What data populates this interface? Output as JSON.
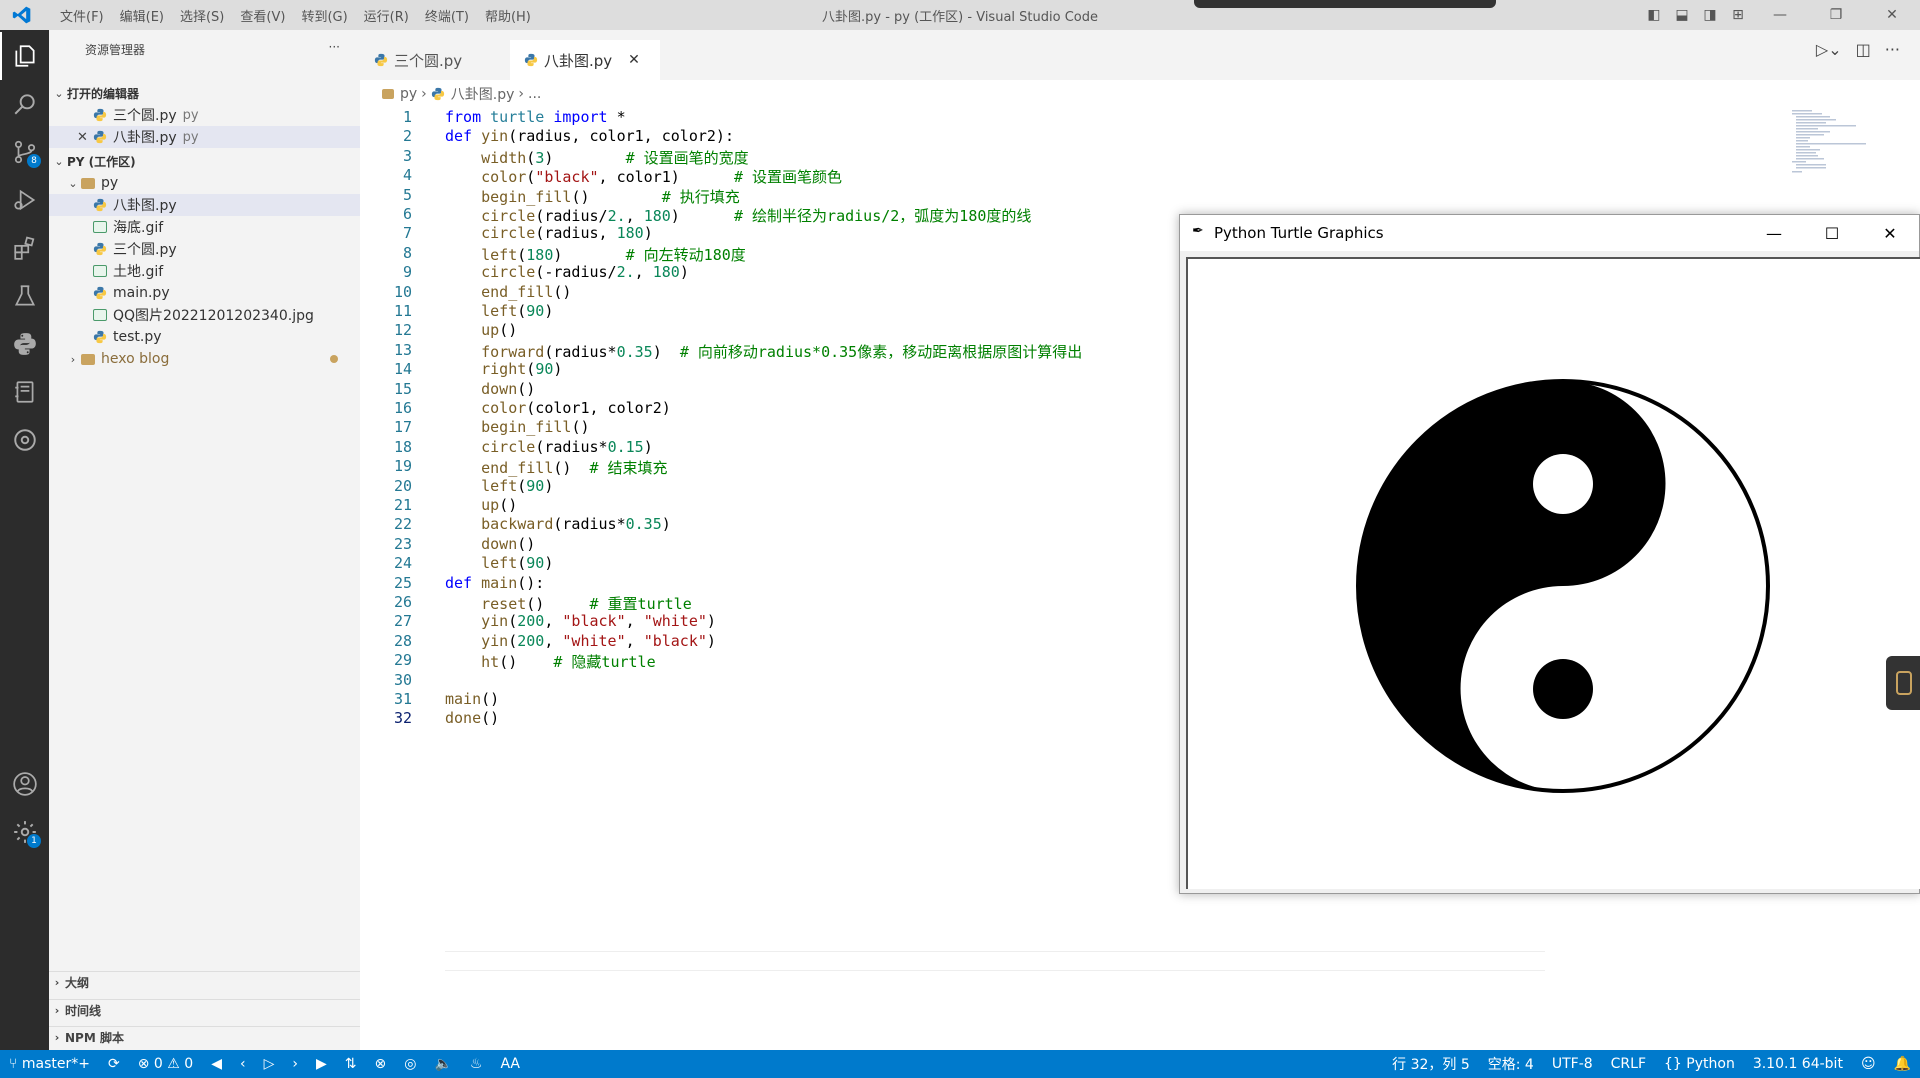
{
  "titlebar": {
    "menu": [
      "文件(F)",
      "编辑(E)",
      "选择(S)",
      "查看(V)",
      "转到(G)",
      "运行(R)",
      "终端(T)",
      "帮助(H)"
    ],
    "title": "八卦图.py - py (工作区) - Visual Studio Code"
  },
  "activity": {
    "scm_badge": "8",
    "settings_badge": "1"
  },
  "sidebar": {
    "header": "资源管理器",
    "more": "···",
    "open_editors": {
      "title": "打开的编辑器",
      "items": [
        {
          "name": "三个圆.py",
          "hint": "py"
        },
        {
          "name": "八卦图.py",
          "hint": "py"
        }
      ]
    },
    "workspace": {
      "title": "PY (工作区)",
      "folder": "py",
      "files": [
        "八卦图.py",
        "海底.gif",
        "三个圆.py",
        "土地.gif",
        "main.py",
        "QQ图片20221201202340.jpg",
        "test.py"
      ],
      "other_folder": "hexo blog"
    },
    "bottom_sections": [
      "大纲",
      "时间线",
      "NPM 脚本"
    ]
  },
  "tabs": [
    {
      "label": "三个圆.py"
    },
    {
      "label": "八卦图.py"
    }
  ],
  "breadcrumb": {
    "a": "py",
    "b": "八卦图.py",
    "c": "..."
  },
  "code_lines": [
    "1",
    "2",
    "3",
    "4",
    "5",
    "6",
    "7",
    "8",
    "9",
    "10",
    "11",
    "12",
    "13",
    "14",
    "15",
    "16",
    "17",
    "18",
    "19",
    "20",
    "21",
    "22",
    "23",
    "24",
    "25",
    "26",
    "27",
    "28",
    "29",
    "30",
    "31",
    "32"
  ],
  "code": {
    "l1": [
      "from",
      " turtle ",
      "import",
      " *"
    ],
    "l2": [
      "def",
      " yin",
      "(radius, color1, color2):"
    ],
    "l3": [
      "    width",
      "(",
      "3",
      ")        ",
      "# 设置画笔的宽度"
    ],
    "l4": [
      "    color",
      "(",
      "\"black\"",
      ", color1)      ",
      "# 设置画笔颜色"
    ],
    "l5": [
      "    begin_fill",
      "()        ",
      "# 执行填充"
    ],
    "l6": [
      "    circle",
      "(radius/",
      "2.",
      ", ",
      "180",
      ")      ",
      "# 绘制半径为radius/2，弧度为180度的线"
    ],
    "l7": [
      "    circle",
      "(radius, ",
      "180",
      ")"
    ],
    "l8": [
      "    left",
      "(",
      "180",
      ")       ",
      "# 向左转动180度"
    ],
    "l9": [
      "    circle",
      "(-radius/",
      "2.",
      ", ",
      "180",
      ")"
    ],
    "l10": [
      "    end_fill",
      "()"
    ],
    "l11": [
      "    left",
      "(",
      "90",
      ")"
    ],
    "l12": [
      "    up",
      "()"
    ],
    "l13": [
      "    forward",
      "(radius*",
      "0.35",
      ")  ",
      "# 向前移动radius*0.35像素，移动距离根据原图计算得出"
    ],
    "l14": [
      "    right",
      "(",
      "90",
      ")"
    ],
    "l15": [
      "    down",
      "()"
    ],
    "l16": [
      "    color",
      "(color1, color2)"
    ],
    "l17": [
      "    begin_fill",
      "()"
    ],
    "l18": [
      "    circle",
      "(radius*",
      "0.15",
      ")"
    ],
    "l19": [
      "    end_fill",
      "()  ",
      "# 结束填充"
    ],
    "l20": [
      "    left",
      "(",
      "90",
      ")"
    ],
    "l21": [
      "    up",
      "()"
    ],
    "l22": [
      "    backward",
      "(radius*",
      "0.35",
      ")"
    ],
    "l23": [
      "    down",
      "()"
    ],
    "l24": [
      "    left",
      "(",
      "90",
      ")"
    ],
    "l25": [
      "def",
      " main",
      "():"
    ],
    "l26": [
      "    reset",
      "()     ",
      "# 重置turtle"
    ],
    "l27": [
      "    yin",
      "(",
      "200",
      ", ",
      "\"black\"",
      ", ",
      "\"white\"",
      ")"
    ],
    "l28": [
      "    yin",
      "(",
      "200",
      ", ",
      "\"white\"",
      ", ",
      "\"black\"",
      ")"
    ],
    "l29": [
      "    ht",
      "()    ",
      "# 隐藏turtle"
    ],
    "l31": [
      "main",
      "()"
    ],
    "l32": [
      "done",
      "()"
    ]
  },
  "turtle_window": {
    "title": "Python Turtle Graphics"
  },
  "statusbar": {
    "branch": "master*+",
    "errors": "0",
    "warnings": "0",
    "position": "行 32，列 5",
    "spaces": "空格: 4",
    "encoding": "UTF-8",
    "eol": "CRLF",
    "language": "Python",
    "interpreter": "3.10.1 64-bit",
    "font_label": "AA"
  },
  "colors": {
    "accent": "#007acc",
    "activity_bar": "#2c2c2c",
    "sidebar": "#f3f3f3"
  }
}
